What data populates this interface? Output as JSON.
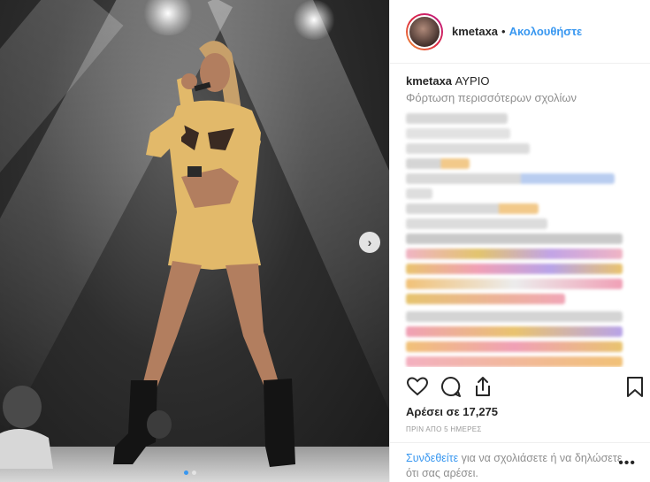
{
  "post": {
    "username": "kmetaxa",
    "separator": "•",
    "follow_label": "Ακολουθήστε",
    "caption_user": "kmetaxa",
    "caption_text": "ΑΥΡΙΟ",
    "load_more_label": "Φόρτωση περισσότερων σχολίων",
    "likes_text": "Αρέσει σε 17,275",
    "timestamp": "ΠΡΙΝ ΑΠΟ 5 ΗΜΕΡΕΣ",
    "login_link": "Συνδεθείτε",
    "login_rest": " για να σχολιάσετε ή να δηλώσετε ότι σας αρέσει.",
    "more_icon": "•••",
    "next_icon": "›"
  },
  "icons": {
    "like": "heart-icon",
    "comment": "comment-icon",
    "share": "share-icon",
    "save": "bookmark-icon"
  },
  "colors": {
    "link_blue": "#3897f0",
    "muted": "#8e8e8e",
    "outfit": "#e2b96a"
  }
}
